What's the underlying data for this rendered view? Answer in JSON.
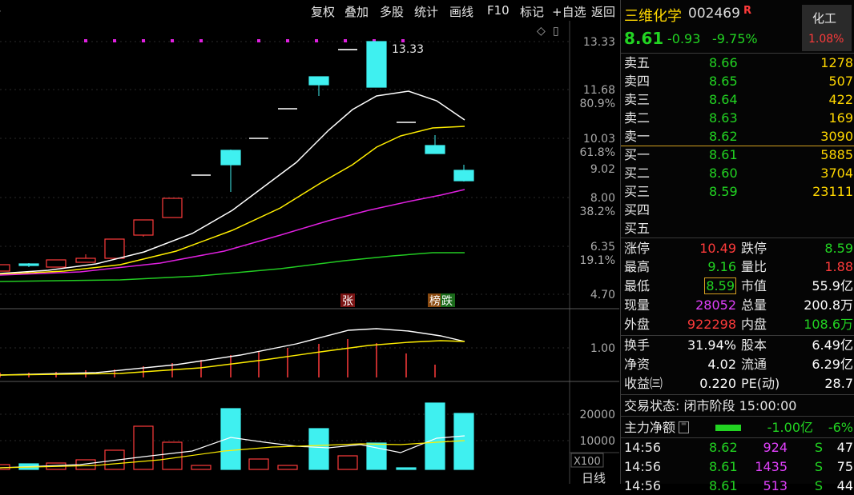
{
  "toolbar": {
    "items": [
      "复权",
      "叠加",
      "多股",
      "统计",
      "画线",
      "F10",
      "标记",
      "+自选",
      "返回"
    ]
  },
  "chart_icons": {
    "diamond": "◇",
    "panel": "▯"
  },
  "price_axis": [
    "13.33",
    "11.68",
    "80.9%",
    "10.03",
    "61.8%",
    "9.02",
    "8.00",
    "38.2%",
    "6.35",
    "19.1%",
    "4.70"
  ],
  "high_label": "13.33",
  "markers": {
    "zhang": "张",
    "bang": "榜",
    "die": "跌"
  },
  "macd_axis": "1.00",
  "volume_axis": [
    "20000",
    "10000",
    "X100"
  ],
  "period_label": "日线",
  "stock": {
    "name": "三维化学",
    "code": "002469",
    "r_badge": "R",
    "price": "8.61",
    "change": "-0.93",
    "change_pct": "-9.75%",
    "sector": "化工",
    "sector_pct": "1.08%"
  },
  "order_book": {
    "asks": [
      {
        "label": "卖五",
        "price": "8.66",
        "vol": "1278"
      },
      {
        "label": "卖四",
        "price": "8.65",
        "vol": "507"
      },
      {
        "label": "卖三",
        "price": "8.64",
        "vol": "422"
      },
      {
        "label": "卖二",
        "price": "8.63",
        "vol": "169"
      },
      {
        "label": "卖一",
        "price": "8.62",
        "vol": "3090"
      }
    ],
    "bids": [
      {
        "label": "买一",
        "price": "8.61",
        "vol": "5885"
      },
      {
        "label": "买二",
        "price": "8.60",
        "vol": "3704"
      },
      {
        "label": "买三",
        "price": "8.59",
        "vol": "23111"
      },
      {
        "label": "买四",
        "price": "",
        "vol": ""
      },
      {
        "label": "买五",
        "price": "",
        "vol": ""
      }
    ]
  },
  "stats": {
    "zhangting_l": "涨停",
    "zhangting_v": "10.49",
    "dieting_l": "跌停",
    "dieting_v": "8.59",
    "high_l": "最高",
    "high_v": "9.16",
    "liangbi_l": "量比",
    "liangbi_v": "1.88",
    "low_l": "最低",
    "low_v": "8.59",
    "shizhi_l": "市值",
    "shizhi_v": "55.9亿",
    "xianliang_l": "现量",
    "xianliang_v": "28052",
    "zongliang_l": "总量",
    "zongliang_v": "200.8万",
    "waipan_l": "外盘",
    "waipan_v": "922298",
    "neipan_l": "内盘",
    "neipan_v": "108.6万",
    "huanshou_l": "换手",
    "huanshou_v": "31.94%",
    "guben_l": "股本",
    "guben_v": "6.49亿",
    "jingzi_l": "净资",
    "jingzi_v": "4.02",
    "liutong_l": "流通",
    "liutong_v": "6.29亿",
    "shouyi_l": "收益㈢",
    "shouyi_v": "0.220",
    "pe_l": "PE(动)",
    "pe_v": "28.7"
  },
  "trade_status": "交易状态: 闭市阶段 15:00:00",
  "net_flow": {
    "label": "主力净额",
    "value": "-1.00亿",
    "pct": "-6%"
  },
  "ticks": [
    {
      "time": "14:56",
      "price": "8.62",
      "vol": "924",
      "side": "S",
      "num": "47"
    },
    {
      "time": "14:56",
      "price": "8.61",
      "vol": "1435",
      "side": "S",
      "num": "75"
    },
    {
      "time": "14:56",
      "price": "8.61",
      "vol": "513",
      "side": "S",
      "num": "44"
    }
  ],
  "colors": {
    "up": "#ff3b3b",
    "down": "#3ff0f0",
    "ma1": "#ffffff",
    "ma2": "#ffee00",
    "ma3": "#e020e0",
    "ma4": "#22cc22"
  }
}
